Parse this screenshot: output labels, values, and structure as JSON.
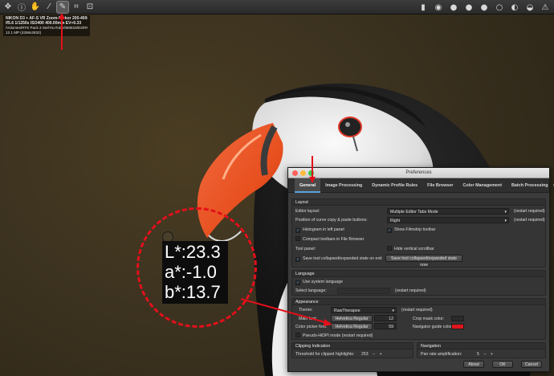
{
  "toolbar": {
    "left_icons": [
      "move-icon",
      "info-icon",
      "hand-icon",
      "wb-picker-icon",
      "color-picker-icon",
      "crop-icon",
      "straighten-icon"
    ],
    "right_icons": [
      "focus-mask-icon",
      "indicator-icon",
      "channel-r-icon",
      "channel-g-icon",
      "channel-b-icon",
      "channel-l-icon",
      "clip-shadow-icon",
      "clip-highlight-icon",
      "clip-alert-icon"
    ]
  },
  "exif": {
    "line1": "NIKON D3 + AF-S VR Zoom-Nikkor 200-400mm f/4G IF-ED",
    "line2": "f/5.6 1/1250s ISO400 400.00mm EV+0.33",
    "line3": "/Volumes/RTE Pack 3 Set/YouTube/050819/D3/RPP0004/2018.NEF",
    "line4": "12.1 MP (4256x2832)"
  },
  "readout": {
    "l": "L*:23.3",
    "a": "a*:-1.0",
    "b": "b*:13.7"
  },
  "prefs": {
    "title": "Preferences",
    "tabs": [
      "General",
      "Image Processing",
      "Dynamic Profile Rules",
      "File Browser",
      "Color Management",
      "Batch Processing"
    ],
    "layout": {
      "header": "Layout",
      "editor_label": "Editor layout:",
      "editor_value": "Multiple Editor Tabs Mode",
      "editor_note": "(restart required)",
      "curve_label": "Position of curve copy & paste buttons:",
      "curve_value": "Right",
      "curve_note": "(restart required)",
      "histogram": "Histogram in left panel",
      "filmstrip": "Show Filmstrip toolbar",
      "compact": "Compact toolbars in File Browser",
      "tool_panel": "Tool panel:",
      "hide_scrollbar": "Hide vertical scrollbar",
      "save_state": "Save tool collapsed/expanded state on exit",
      "save_now": "Save tool collapsed/expanded state now"
    },
    "language": {
      "header": "Language",
      "use_system": "Use system language",
      "select_label": "Select language:",
      "select_note": "(restart required)"
    },
    "appearance": {
      "header": "Appearance",
      "theme_label": "Theme:",
      "theme_value": "RawTherapee",
      "theme_note": "(restart required)",
      "main_font_label": "Main font:",
      "main_font_value": "Helvetica Regular",
      "main_font_size": "12",
      "picker_font_label": "Color picker font:",
      "picker_font_value": "Helvetica Regular",
      "picker_font_size": "59",
      "crop_mask_label": "Crop mask color:",
      "nav_guide_label": "Navigator guide color:",
      "crop_mask_color": "#2a2a2a",
      "nav_guide_color": "#e0151b",
      "pseudo_hidpi": "Pseudo-HiDPI mode (restart required)"
    },
    "clipping": {
      "header": "Clipping Indication",
      "threshold_label": "Threshold for clipped highlights:",
      "threshold_value": "253"
    },
    "navigation": {
      "header": "Navigation",
      "pan_label": "Pan rate amplification:",
      "pan_value": "5"
    },
    "buttons": {
      "about": "About",
      "ok": "OK",
      "cancel": "Cancel"
    }
  }
}
